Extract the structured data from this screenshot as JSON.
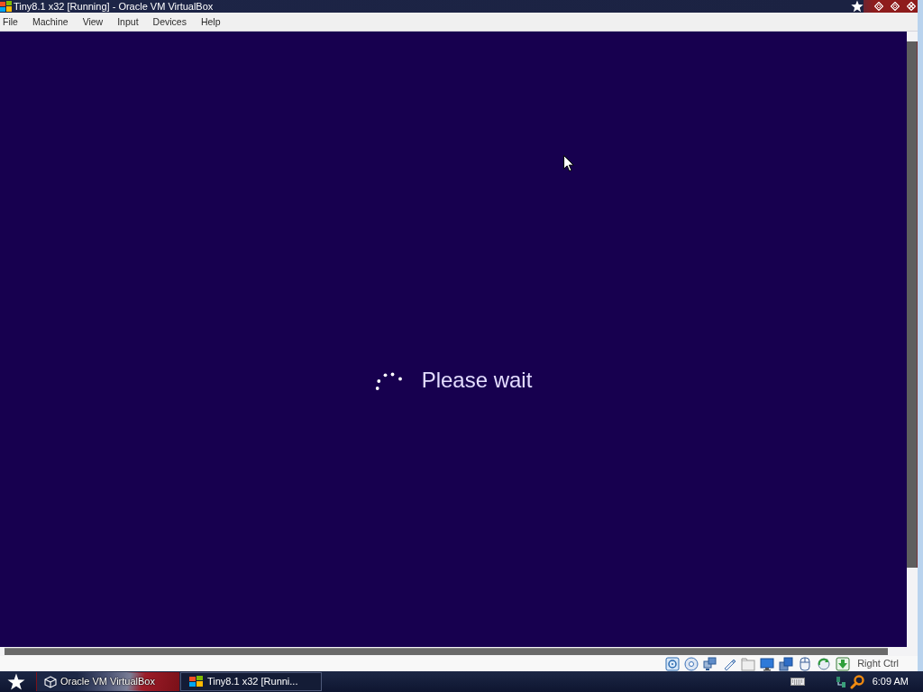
{
  "window": {
    "title": "Tiny8.1 x32 [Running] - Oracle VM VirtualBox"
  },
  "menu_bar": [
    {
      "label": "File"
    },
    {
      "label": "Machine"
    },
    {
      "label": "View"
    },
    {
      "label": "Input"
    },
    {
      "label": "Devices"
    },
    {
      "label": "Help"
    }
  ],
  "vm_screen": {
    "message": "Please wait"
  },
  "status_bar": {
    "host_key": "Right Ctrl"
  },
  "taskbar": {
    "tasks": [
      {
        "label": "Oracle VM VirtualBox",
        "selected": false
      },
      {
        "label": "Tiny8.1 x32 [Runni...",
        "selected": true
      }
    ],
    "clock": "6:09 AM"
  }
}
